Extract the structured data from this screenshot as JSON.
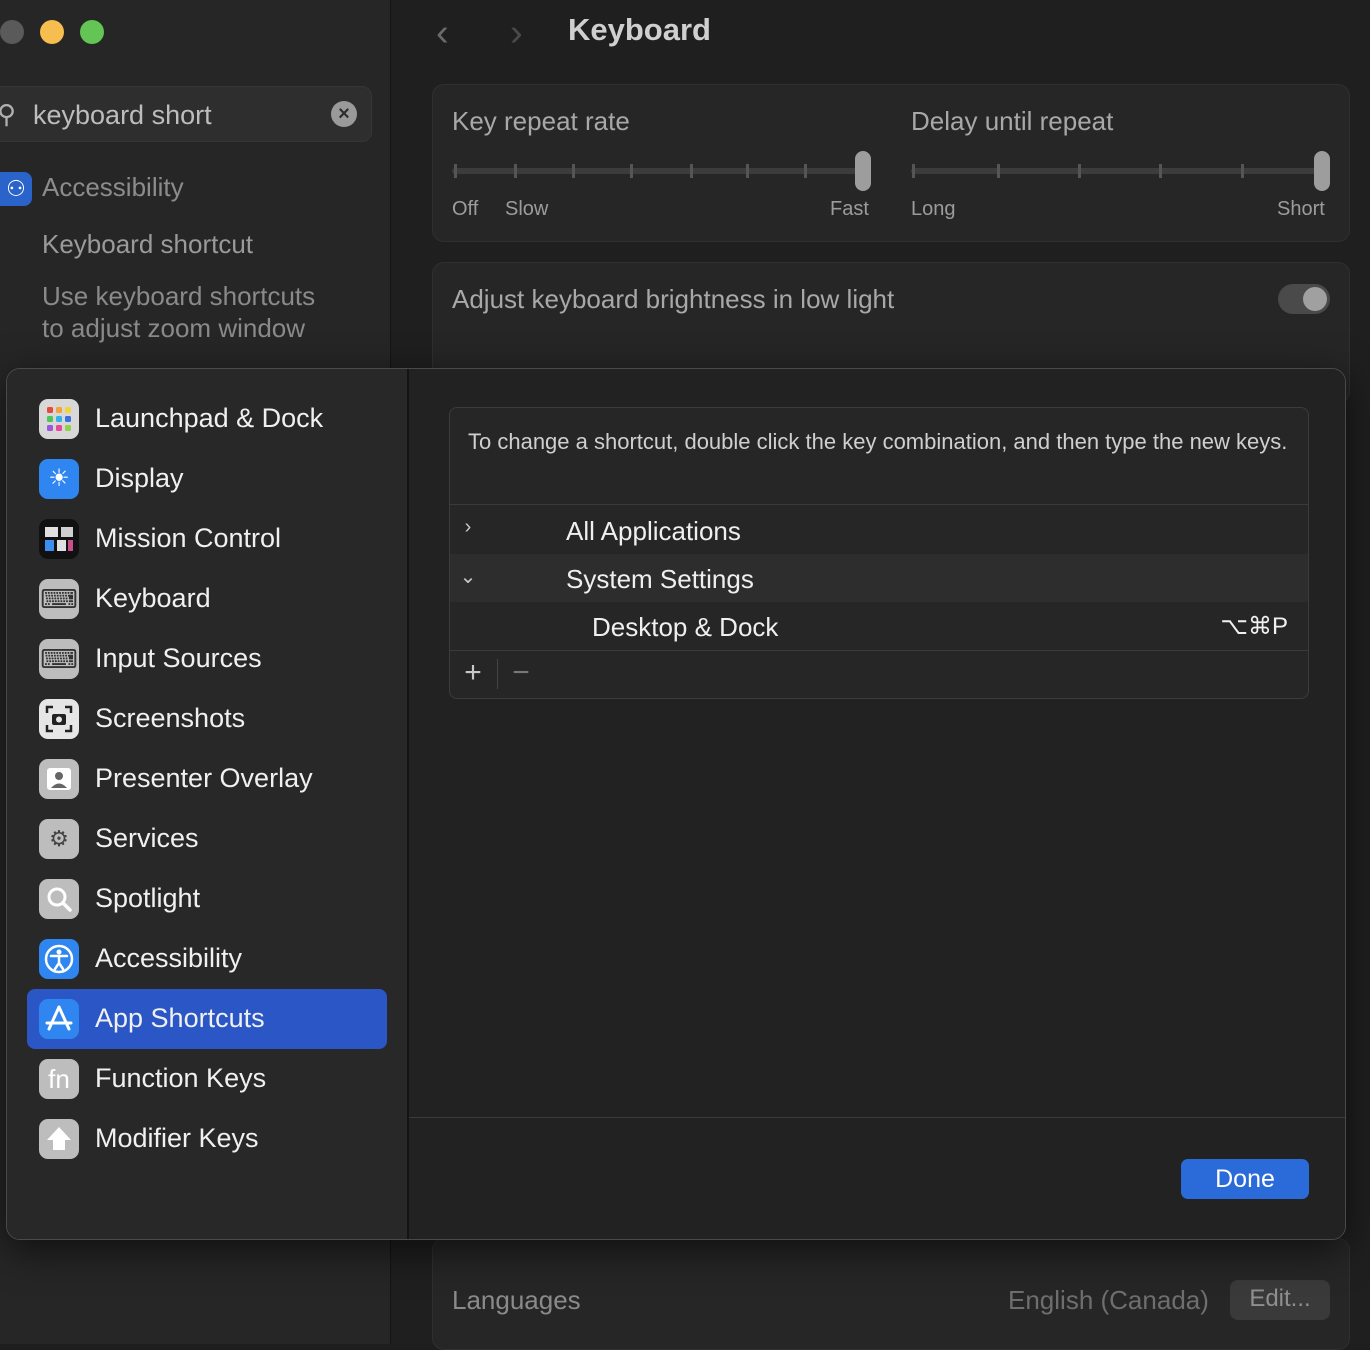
{
  "window": {
    "title": "Keyboard",
    "traffic_colors": {
      "close": "#5a5a5a",
      "minimize": "#f6be4f",
      "zoom": "#62c554"
    }
  },
  "sidebar": {
    "search_value": "keyboard short",
    "result_section": "Accessibility",
    "result_items": [
      {
        "label": "Keyboard shortcut"
      },
      {
        "line1": "Use keyboard shortcuts",
        "line2": "to adjust zoom window"
      }
    ]
  },
  "keyboard_page": {
    "key_repeat": {
      "label": "Key repeat rate",
      "min": "Off",
      "slow": "Slow",
      "max": "Fast",
      "level": 1.0
    },
    "delay": {
      "label": "Delay until repeat",
      "min": "Long",
      "max": "Short",
      "level": 1.0
    },
    "brightness_toggle": {
      "label": "Adjust keyboard brightness in low light",
      "on": false
    },
    "languages": {
      "label": "Languages",
      "value": "English (Canada)",
      "edit": "Edit..."
    }
  },
  "sheet": {
    "sidebar_items": [
      {
        "label": "Launchpad & Dock",
        "icon": "launchpad-icon"
      },
      {
        "label": "Display",
        "icon": "display-icon"
      },
      {
        "label": "Mission Control",
        "icon": "mission-control-icon"
      },
      {
        "label": "Keyboard",
        "icon": "keyboard-icon"
      },
      {
        "label": "Input Sources",
        "icon": "input-sources-icon"
      },
      {
        "label": "Screenshots",
        "icon": "screenshot-icon"
      },
      {
        "label": "Presenter Overlay",
        "icon": "presenter-overlay-icon"
      },
      {
        "label": "Services",
        "icon": "services-icon"
      },
      {
        "label": "Spotlight",
        "icon": "spotlight-icon"
      },
      {
        "label": "Accessibility",
        "icon": "accessibility-icon"
      },
      {
        "label": "App Shortcuts",
        "icon": "app-store-icon",
        "selected": true
      },
      {
        "label": "Function Keys",
        "icon": "fn-icon"
      },
      {
        "label": "Modifier Keys",
        "icon": "modifier-keys-icon"
      }
    ],
    "hint": "To change a shortcut, double click the key combination, and then type the new keys.",
    "rows": [
      {
        "label": "All Applications",
        "expanded": false
      },
      {
        "label": "System Settings",
        "expanded": true
      },
      {
        "label": "Desktop & Dock",
        "keys": "⌥⌘P"
      }
    ],
    "add_label": "+",
    "remove_label": "−",
    "done_label": "Done",
    "accent_color": "#2b6ad9"
  }
}
